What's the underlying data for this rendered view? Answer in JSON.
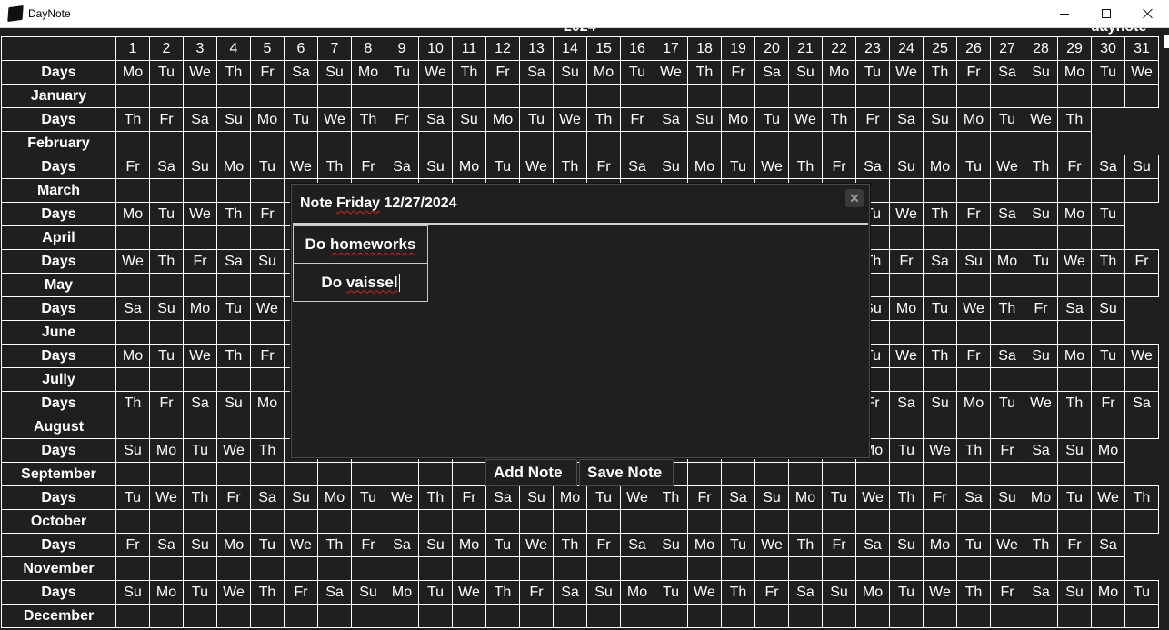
{
  "window": {
    "title": "DayNote"
  },
  "toolbar": {
    "year": "2024",
    "app_label": "daynote"
  },
  "calendar": {
    "day_numbers": [
      "1",
      "2",
      "3",
      "4",
      "5",
      "6",
      "7",
      "8",
      "9",
      "10",
      "11",
      "12",
      "13",
      "14",
      "15",
      "16",
      "17",
      "18",
      "19",
      "20",
      "21",
      "22",
      "23",
      "24",
      "25",
      "26",
      "27",
      "28",
      "29",
      "30",
      "31"
    ],
    "days_label": "Days",
    "months": [
      {
        "name": "January",
        "days": [
          "Mo",
          "Tu",
          "We",
          "Th",
          "Fr",
          "Sa",
          "Su",
          "Mo",
          "Tu",
          "We",
          "Th",
          "Fr",
          "Sa",
          "Su",
          "Mo",
          "Tu",
          "We",
          "Th",
          "Fr",
          "Sa",
          "Su",
          "Mo",
          "Tu",
          "We",
          "Th",
          "Fr",
          "Sa",
          "Su",
          "Mo",
          "Tu",
          "We"
        ]
      },
      {
        "name": "February",
        "days": [
          "Th",
          "Fr",
          "Sa",
          "Su",
          "Mo",
          "Tu",
          "We",
          "Th",
          "Fr",
          "Sa",
          "Su",
          "Mo",
          "Tu",
          "We",
          "Th",
          "Fr",
          "Sa",
          "Su",
          "Mo",
          "Tu",
          "We",
          "Th",
          "Fr",
          "Sa",
          "Su",
          "Mo",
          "Tu",
          "We",
          "Th"
        ]
      },
      {
        "name": "March",
        "days": [
          "Fr",
          "Sa",
          "Su",
          "Mo",
          "Tu",
          "We",
          "Th",
          "Fr",
          "Sa",
          "Su",
          "Mo",
          "Tu",
          "We",
          "Th",
          "Fr",
          "Sa",
          "Su",
          "Mo",
          "Tu",
          "We",
          "Th",
          "Fr",
          "Sa",
          "Su",
          "Mo",
          "Tu",
          "We",
          "Th",
          "Fr",
          "Sa",
          "Su"
        ]
      },
      {
        "name": "April",
        "days": [
          "Mo",
          "Tu",
          "We",
          "Th",
          "Fr",
          "Sa",
          "Su",
          "Mo",
          "Tu",
          "We",
          "Th",
          "Fr",
          "Sa",
          "Su",
          "Mo",
          "Tu",
          "We",
          "Th",
          "Fr",
          "Sa",
          "Su",
          "Mo",
          "Tu",
          "We",
          "Th",
          "Fr",
          "Sa",
          "Su",
          "Mo",
          "Tu"
        ]
      },
      {
        "name": "May",
        "days": [
          "We",
          "Th",
          "Fr",
          "Sa",
          "Su",
          "Mo",
          "Tu",
          "We",
          "Th",
          "Fr",
          "Sa",
          "Su",
          "Mo",
          "Tu",
          "We",
          "Th",
          "Fr",
          "Sa",
          "Su",
          "Mo",
          "Tu",
          "We",
          "Th",
          "Fr",
          "Sa",
          "Su",
          "Mo",
          "Tu",
          "We",
          "Th",
          "Fr"
        ]
      },
      {
        "name": "June",
        "days": [
          "Sa",
          "Su",
          "Mo",
          "Tu",
          "We",
          "Th",
          "Fr",
          "Sa",
          "Su",
          "Mo",
          "Tu",
          "We",
          "Th",
          "Fr",
          "Sa",
          "Su",
          "Mo",
          "Tu",
          "We",
          "Th",
          "Fr",
          "Sa",
          "Su",
          "Mo",
          "Tu",
          "We",
          "Th",
          "Fr",
          "Sa",
          "Su"
        ]
      },
      {
        "name": "Jully",
        "days": [
          "Mo",
          "Tu",
          "We",
          "Th",
          "Fr",
          "Sa",
          "Su",
          "Mo",
          "Tu",
          "We",
          "Th",
          "Fr",
          "Sa",
          "Su",
          "Mo",
          "Tu",
          "We",
          "Th",
          "Fr",
          "Sa",
          "Su",
          "Mo",
          "Tu",
          "We",
          "Th",
          "Fr",
          "Sa",
          "Su",
          "Mo",
          "Tu",
          "We"
        ]
      },
      {
        "name": "August",
        "days": [
          "Th",
          "Fr",
          "Sa",
          "Su",
          "Mo",
          "Tu",
          "We",
          "Th",
          "Fr",
          "Sa",
          "Su",
          "Mo",
          "Tu",
          "We",
          "Th",
          "Fr",
          "Sa",
          "Su",
          "Mo",
          "Tu",
          "We",
          "Th",
          "Fr",
          "Sa",
          "Su",
          "Mo",
          "Tu",
          "We",
          "Th",
          "Fr",
          "Sa"
        ]
      },
      {
        "name": "September",
        "days": [
          "Su",
          "Mo",
          "Tu",
          "We",
          "Th",
          "Fr",
          "Sa",
          "Su",
          "Mo",
          "Tu",
          "We",
          "Th",
          "Fr",
          "Sa",
          "Su",
          "Mo",
          "Tu",
          "We",
          "Th",
          "Fr",
          "Sa",
          "Su",
          "Mo",
          "Tu",
          "We",
          "Th",
          "Fr",
          "Sa",
          "Su",
          "Mo"
        ]
      },
      {
        "name": "October",
        "days": [
          "Tu",
          "We",
          "Th",
          "Fr",
          "Sa",
          "Su",
          "Mo",
          "Tu",
          "We",
          "Th",
          "Fr",
          "Sa",
          "Su",
          "Mo",
          "Tu",
          "We",
          "Th",
          "Fr",
          "Sa",
          "Su",
          "Mo",
          "Tu",
          "We",
          "Th",
          "Fr",
          "Sa",
          "Su",
          "Mo",
          "Tu",
          "We",
          "Th"
        ]
      },
      {
        "name": "November",
        "days": [
          "Fr",
          "Sa",
          "Su",
          "Mo",
          "Tu",
          "We",
          "Th",
          "Fr",
          "Sa",
          "Su",
          "Mo",
          "Tu",
          "We",
          "Th",
          "Fr",
          "Sa",
          "Su",
          "Mo",
          "Tu",
          "We",
          "Th",
          "Fr",
          "Sa",
          "Su",
          "Mo",
          "Tu",
          "We",
          "Th",
          "Fr",
          "Sa"
        ]
      },
      {
        "name": "December",
        "days": [
          "Su",
          "Mo",
          "Tu",
          "We",
          "Th",
          "Fr",
          "Sa",
          "Su",
          "Mo",
          "Tu",
          "We",
          "Th",
          "Fr",
          "Sa",
          "Su",
          "Mo",
          "Tu",
          "We",
          "Th",
          "Fr",
          "Sa",
          "Su",
          "Mo",
          "Tu",
          "We",
          "Th",
          "Fr",
          "Sa",
          "Su",
          "Mo",
          "Tu"
        ]
      }
    ]
  },
  "note_dialog": {
    "title": "Note Friday 12/27/2024",
    "close_icon": "close-icon",
    "notes": [
      {
        "text": "Do homeworks"
      },
      {
        "text": "Do vaissel"
      }
    ]
  },
  "actions": {
    "add_label": "Add Note",
    "save_label": "Save Note"
  },
  "colors": {
    "background": "#1f1f1f",
    "grid_line": "#ffffff",
    "text": "#ffffff"
  }
}
